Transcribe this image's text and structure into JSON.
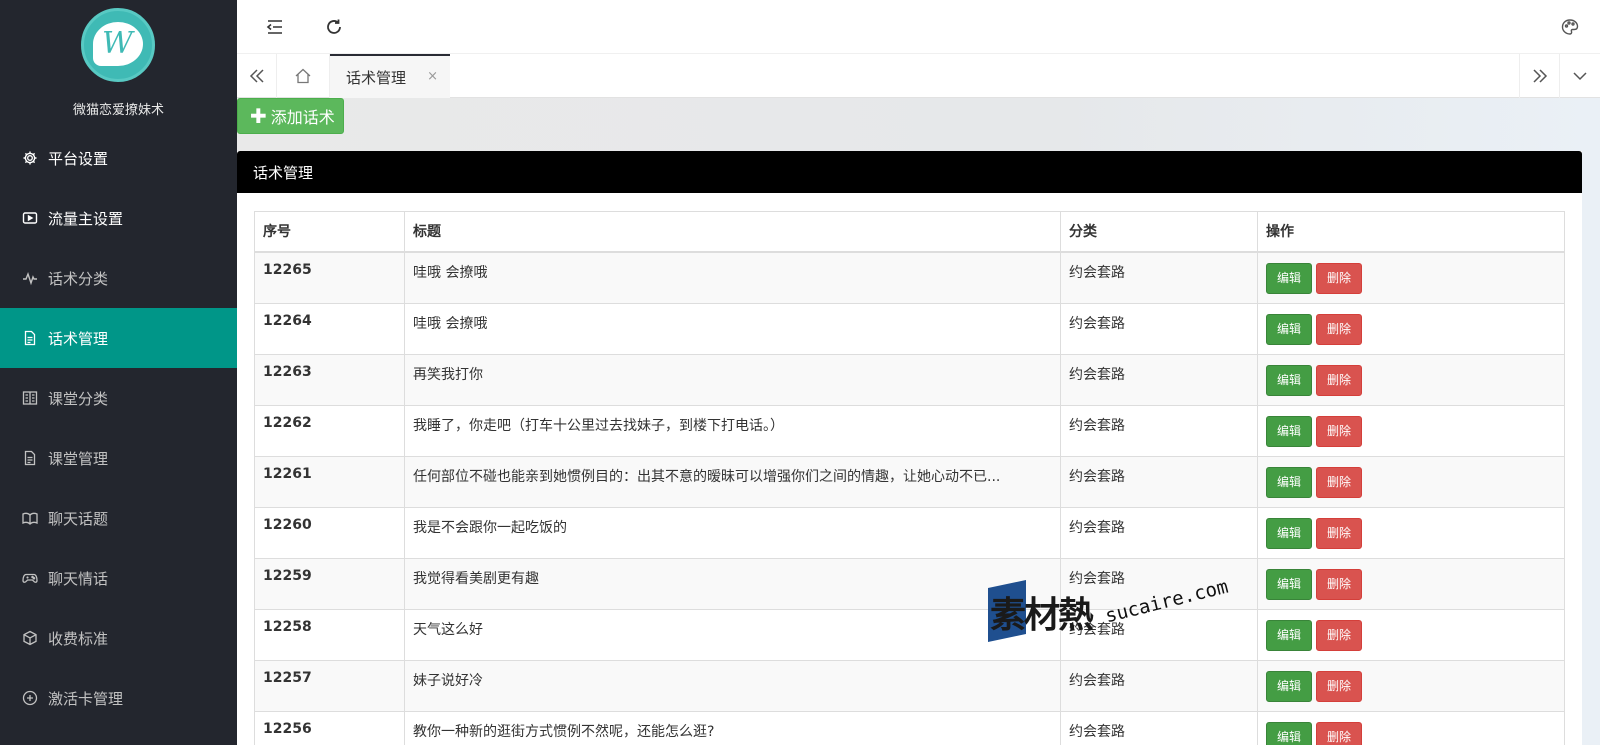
{
  "app": {
    "site_name": "微猫恋爱撩妹术"
  },
  "sidebar": {
    "items": [
      {
        "label": "平台设置",
        "icon": "gear-icon"
      },
      {
        "label": "流量主设置",
        "icon": "video-icon"
      },
      {
        "label": "话术分类",
        "icon": "pulse-icon"
      },
      {
        "label": "话术管理",
        "icon": "document-icon",
        "active": true
      },
      {
        "label": "课堂分类",
        "icon": "reader-icon"
      },
      {
        "label": "课堂管理",
        "icon": "document-icon"
      },
      {
        "label": "聊天话题",
        "icon": "book-open-icon"
      },
      {
        "label": "聊天情话",
        "icon": "gamepad-icon"
      },
      {
        "label": "收费标准",
        "icon": "cube-icon"
      },
      {
        "label": "激活卡管理",
        "icon": "plus-circle-icon"
      }
    ]
  },
  "tabs": {
    "active_label": "话术管理",
    "close_symbol": "×"
  },
  "toolbar": {
    "add_label": "添加话术",
    "add_symbol": "✚"
  },
  "panel": {
    "title": "话术管理"
  },
  "table": {
    "headers": {
      "id": "序号",
      "title": "标题",
      "category": "分类",
      "actions": "操作"
    },
    "edit_label": "编辑",
    "delete_label": "删除",
    "rows": [
      {
        "id": "12265",
        "title": "哇哦 会撩哦",
        "category": "约会套路"
      },
      {
        "id": "12264",
        "title": "哇哦 会撩哦",
        "category": "约会套路"
      },
      {
        "id": "12263",
        "title": "再笑我打你",
        "category": "约会套路"
      },
      {
        "id": "12262",
        "title": "我睡了，你走吧（打车十公里过去找妹子，到楼下打电话。）",
        "category": "约会套路"
      },
      {
        "id": "12261",
        "title": "任何部位不碰也能亲到她惯例目的：出其不意的暧昧可以增强你们之间的情趣，让她心动不已...",
        "category": "约会套路"
      },
      {
        "id": "12260",
        "title": "我是不会跟你一起吃饭的",
        "category": "约会套路"
      },
      {
        "id": "12259",
        "title": "我觉得看美剧更有趣",
        "category": "约会套路"
      },
      {
        "id": "12258",
        "title": "天气这么好",
        "category": "约会套路"
      },
      {
        "id": "12257",
        "title": "妹子说好冷",
        "category": "约会套路"
      },
      {
        "id": "12256",
        "title": "教你一种新的逛街方式惯例不然呢，还能怎么逛?",
        "category": "约会套路"
      }
    ]
  },
  "watermark": {
    "brand": "素材熱",
    "url": "sucaire.com"
  }
}
